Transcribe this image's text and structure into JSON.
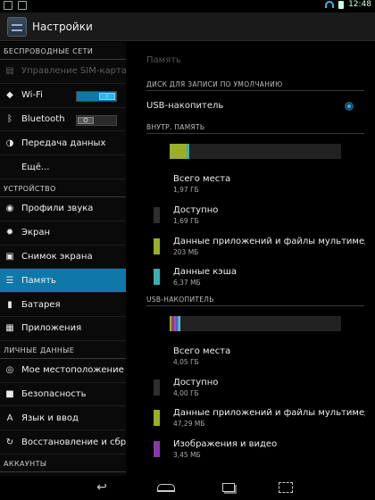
{
  "status_bar": {
    "time": "12:48",
    "icons": [
      "screenshot-icon",
      "picture-icon",
      "wifi-icon",
      "battery-icon"
    ]
  },
  "action_bar": {
    "title": "Настройки",
    "icon": "settings-icon"
  },
  "sidebar": {
    "sections": [
      {
        "header": "БЕСПРОВОДНЫЕ СЕТИ",
        "items": [
          {
            "label": "Управление SIM-картами",
            "icon": "sim-icon",
            "disabled": true
          },
          {
            "label": "Wi-Fi",
            "icon": "wifi-icon",
            "toggle": "on",
            "toggle_label": "I"
          },
          {
            "label": "Bluetooth",
            "icon": "bluetooth-icon",
            "toggle": "off",
            "toggle_label": "O"
          },
          {
            "label": "Передача данных",
            "icon": "data-usage-icon"
          },
          {
            "label": "Ещё...",
            "icon": ""
          }
        ]
      },
      {
        "header": "УСТРОЙСТВО",
        "items": [
          {
            "label": "Профили звука",
            "icon": "sound-icon"
          },
          {
            "label": "Экран",
            "icon": "display-icon"
          },
          {
            "label": "Снимок экрана",
            "icon": "camera-icon"
          },
          {
            "label": "Память",
            "icon": "storage-icon",
            "selected": true
          },
          {
            "label": "Батарея",
            "icon": "battery-icon"
          },
          {
            "label": "Приложения",
            "icon": "apps-icon"
          }
        ]
      },
      {
        "header": "ЛИЧНЫЕ ДАННЫЕ",
        "items": [
          {
            "label": "Мое местоположение",
            "icon": "location-icon"
          },
          {
            "label": "Безопасность",
            "icon": "lock-icon"
          },
          {
            "label": "Язык и ввод",
            "icon": "language-icon"
          },
          {
            "label": "Восстановление и сброс",
            "icon": "restore-icon"
          }
        ]
      },
      {
        "header": "АККАУНТЫ",
        "items": []
      }
    ]
  },
  "main": {
    "title": "Память",
    "default_disk_header": "ДИСК ДЛЯ ЗАПИСИ ПО УМОЛЧАНИЮ",
    "default_disk_option": "USB-накопитель",
    "internal": {
      "header": "ВНУТР. ПАМЯТЬ",
      "bar": [
        {
          "color": "#9aae26",
          "fraction": 0.1
        },
        {
          "color": "#3ab0b4",
          "fraction": 0.015
        }
      ],
      "stats": [
        {
          "label": "Всего места",
          "value": "1,97 ГБ",
          "color": ""
        },
        {
          "label": "Доступно",
          "value": "1,69 ГБ",
          "color": "#2e2e2e"
        },
        {
          "label": "Данные приложений и файлы мультимедиа",
          "value": "203 МБ",
          "color": "#9aae26"
        },
        {
          "label": "Данные кэша",
          "value": "6,37 МБ",
          "color": "#3ab0b4"
        }
      ]
    },
    "usb": {
      "header": "USB-НАКОПИТЕЛЬ",
      "bar": [
        {
          "color": "#9aae26",
          "fraction": 0.012
        },
        {
          "color": "#8a3aa8",
          "fraction": 0.012
        },
        {
          "color": "#c24a8a",
          "fraction": 0.01
        },
        {
          "color": "#3a6ad0",
          "fraction": 0.012
        },
        {
          "color": "#4aa8c8",
          "fraction": 0.01
        },
        {
          "color": "#b8b8b8",
          "fraction": 0.008
        }
      ],
      "stats": [
        {
          "label": "Всего места",
          "value": "4,05 ГБ",
          "color": ""
        },
        {
          "label": "Доступно",
          "value": "4,00 ГБ",
          "color": "#2e2e2e"
        },
        {
          "label": "Данные приложений и файлы мультимедиа",
          "value": "47,29 МБ",
          "color": "#9aae26"
        },
        {
          "label": "Изображения и видео",
          "value": "3,45 МБ",
          "color": "#8a3aa8"
        }
      ]
    }
  }
}
